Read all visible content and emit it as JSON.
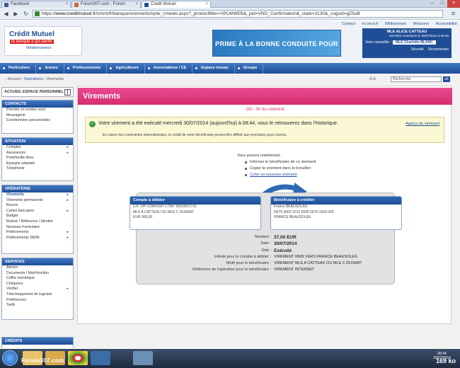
{
  "browser": {
    "tabs": [
      {
        "label": "Facebook",
        "fav_color": "#3b5998"
      },
      {
        "label": "Forum307.com - Forum",
        "fav_color": "#cc6633"
      },
      {
        "label": "Crédit Mutuel",
        "fav_color": "#1f4e96"
      }
    ],
    "url_domain": "www.creditmutuel.fr",
    "url_path": "/cmmi/fr/banque/virements/vplw_cmweb.aspx?_productfilter=VPLWWEB&_pid=VND_Confirmation&_state=3130&_cogsid=gZ5uB"
  },
  "header": {
    "logo_name": "Crédit Mutuel",
    "logo_tagline": "la banque à qui parler",
    "logo_region": "Méditerranéen",
    "banner": "PRIME À LA BONNE CONDUITE POUR TOUS !",
    "toplinks": [
      "Contact",
      "m.cmut.fr",
      "Willkommen",
      "Welcome",
      "Accessibilité"
    ],
    "user_name": "MLE ALICE CATTEAU",
    "last_login": "Dernière connexion le 30/07/2014 à 08:26",
    "advisor_label": "Votre conseiller :",
    "advisor_name": "MLE Charlotte BLANC",
    "security": "Sécurité",
    "logout": "Déconnexion"
  },
  "nav": [
    "Particuliers",
    "Jeunes",
    "Professionnels",
    "Agriculteurs",
    "Associations / CE",
    "Espace réseau",
    "Groupe"
  ],
  "crumbs": {
    "a": "Accueil",
    "b": "Opérations",
    "c": "Virements"
  },
  "font_size_label": "A A",
  "search_placeholder": "Rechercher",
  "search_button": "ok",
  "sidebar": {
    "accueil": "ACCUEIL ESPACE PERSONNEL",
    "contacts": {
      "title": "CONTACTS",
      "items": [
        "Prendre un rendez-vous",
        "Messagerie",
        "Coordonnées personnelles"
      ]
    },
    "situation": {
      "title": "SITUATION",
      "items": [
        "Comptes",
        "Assurances",
        "Portefeuille titres",
        "Épargne salariale",
        "Téléphonie"
      ]
    },
    "operations": {
      "title": "OPÉRATIONS",
      "items": [
        "Virements",
        "Virements permanents",
        "Bourse",
        "Cartes bancaires",
        "Budget",
        "Relevé / Référence / Identité",
        "Nouveau Formulaire",
        "Prélèvements",
        "Prélèvements SEPA"
      ]
    },
    "services": {
      "title": "SERVICES",
      "items": [
        "Alertes",
        "Documents / Mail-fonction",
        "Coffre numérique",
        "Chéquiers",
        "Vérifier",
        "Téléchargement de logiciels",
        "Préférences",
        "Tarifs"
      ]
    },
    "credits": {
      "title": "CRÉDITS"
    }
  },
  "main": {
    "title": "Virements",
    "subtitle": "OO - fin du virement",
    "confirm_msg": "Votre virement a été exécuté mercredi 30/07/2014 (aujourd'hui) à 08:44, vous le retrouverez dans l'historique.",
    "confirm_sub": "En raison des contraintes internationales, le crédit de votre bénéficiaire pourra être différé aux prochains jours ouvrés.",
    "print": "Aperçu du virement",
    "actions_intro": "Vous pouvez maintenant :",
    "actions": [
      "Informer le bénéficiaire de ce virement",
      "Copier le virement dans le brouillon",
      "Créer un nouveau virement"
    ],
    "debit_title": "Compte à débiter",
    "debit_lines": [
      "C/C VIP CONFORT 17367 00020072 01",
      "MLE A CATTEAU OU MLE C DUSART",
      "EUR 900,00"
    ],
    "credit_title": "Bénéficiaire à créditer",
    "credit_lines": [
      "France BEAUSOLEIL",
      "FR76 3000 2012 5000 0070 1500 000",
      "FRANCE BEAUSOLEIL"
    ],
    "rows": [
      {
        "label": "Montant :",
        "value": "37,00 EUR",
        "bold": true
      },
      {
        "label": "Date :",
        "value": "30/07/2014",
        "bold": true
      },
      {
        "label": "État :",
        "value": "Exécuté",
        "bold": true
      },
      {
        "label": "Intitulé pour le compte à débiter :",
        "value": "VIREMENT WEB VERS FRANCE BEAUSOLEIL",
        "bold": false
      },
      {
        "label": "Motif pour le bénéficiaire :",
        "value": "VIREMENT MLE A CATTEAU OU MLE C DUSART",
        "bold": false
      },
      {
        "label": "Référence de l'opération pour le bénéficiaire :",
        "value": "VIREMENT INTERNET",
        "bold": false
      }
    ]
  },
  "taskbar": {
    "watermark": "Forum307.com",
    "size": "169 ko",
    "clock_time": "08:44",
    "clock_date": "30/07/2014"
  }
}
